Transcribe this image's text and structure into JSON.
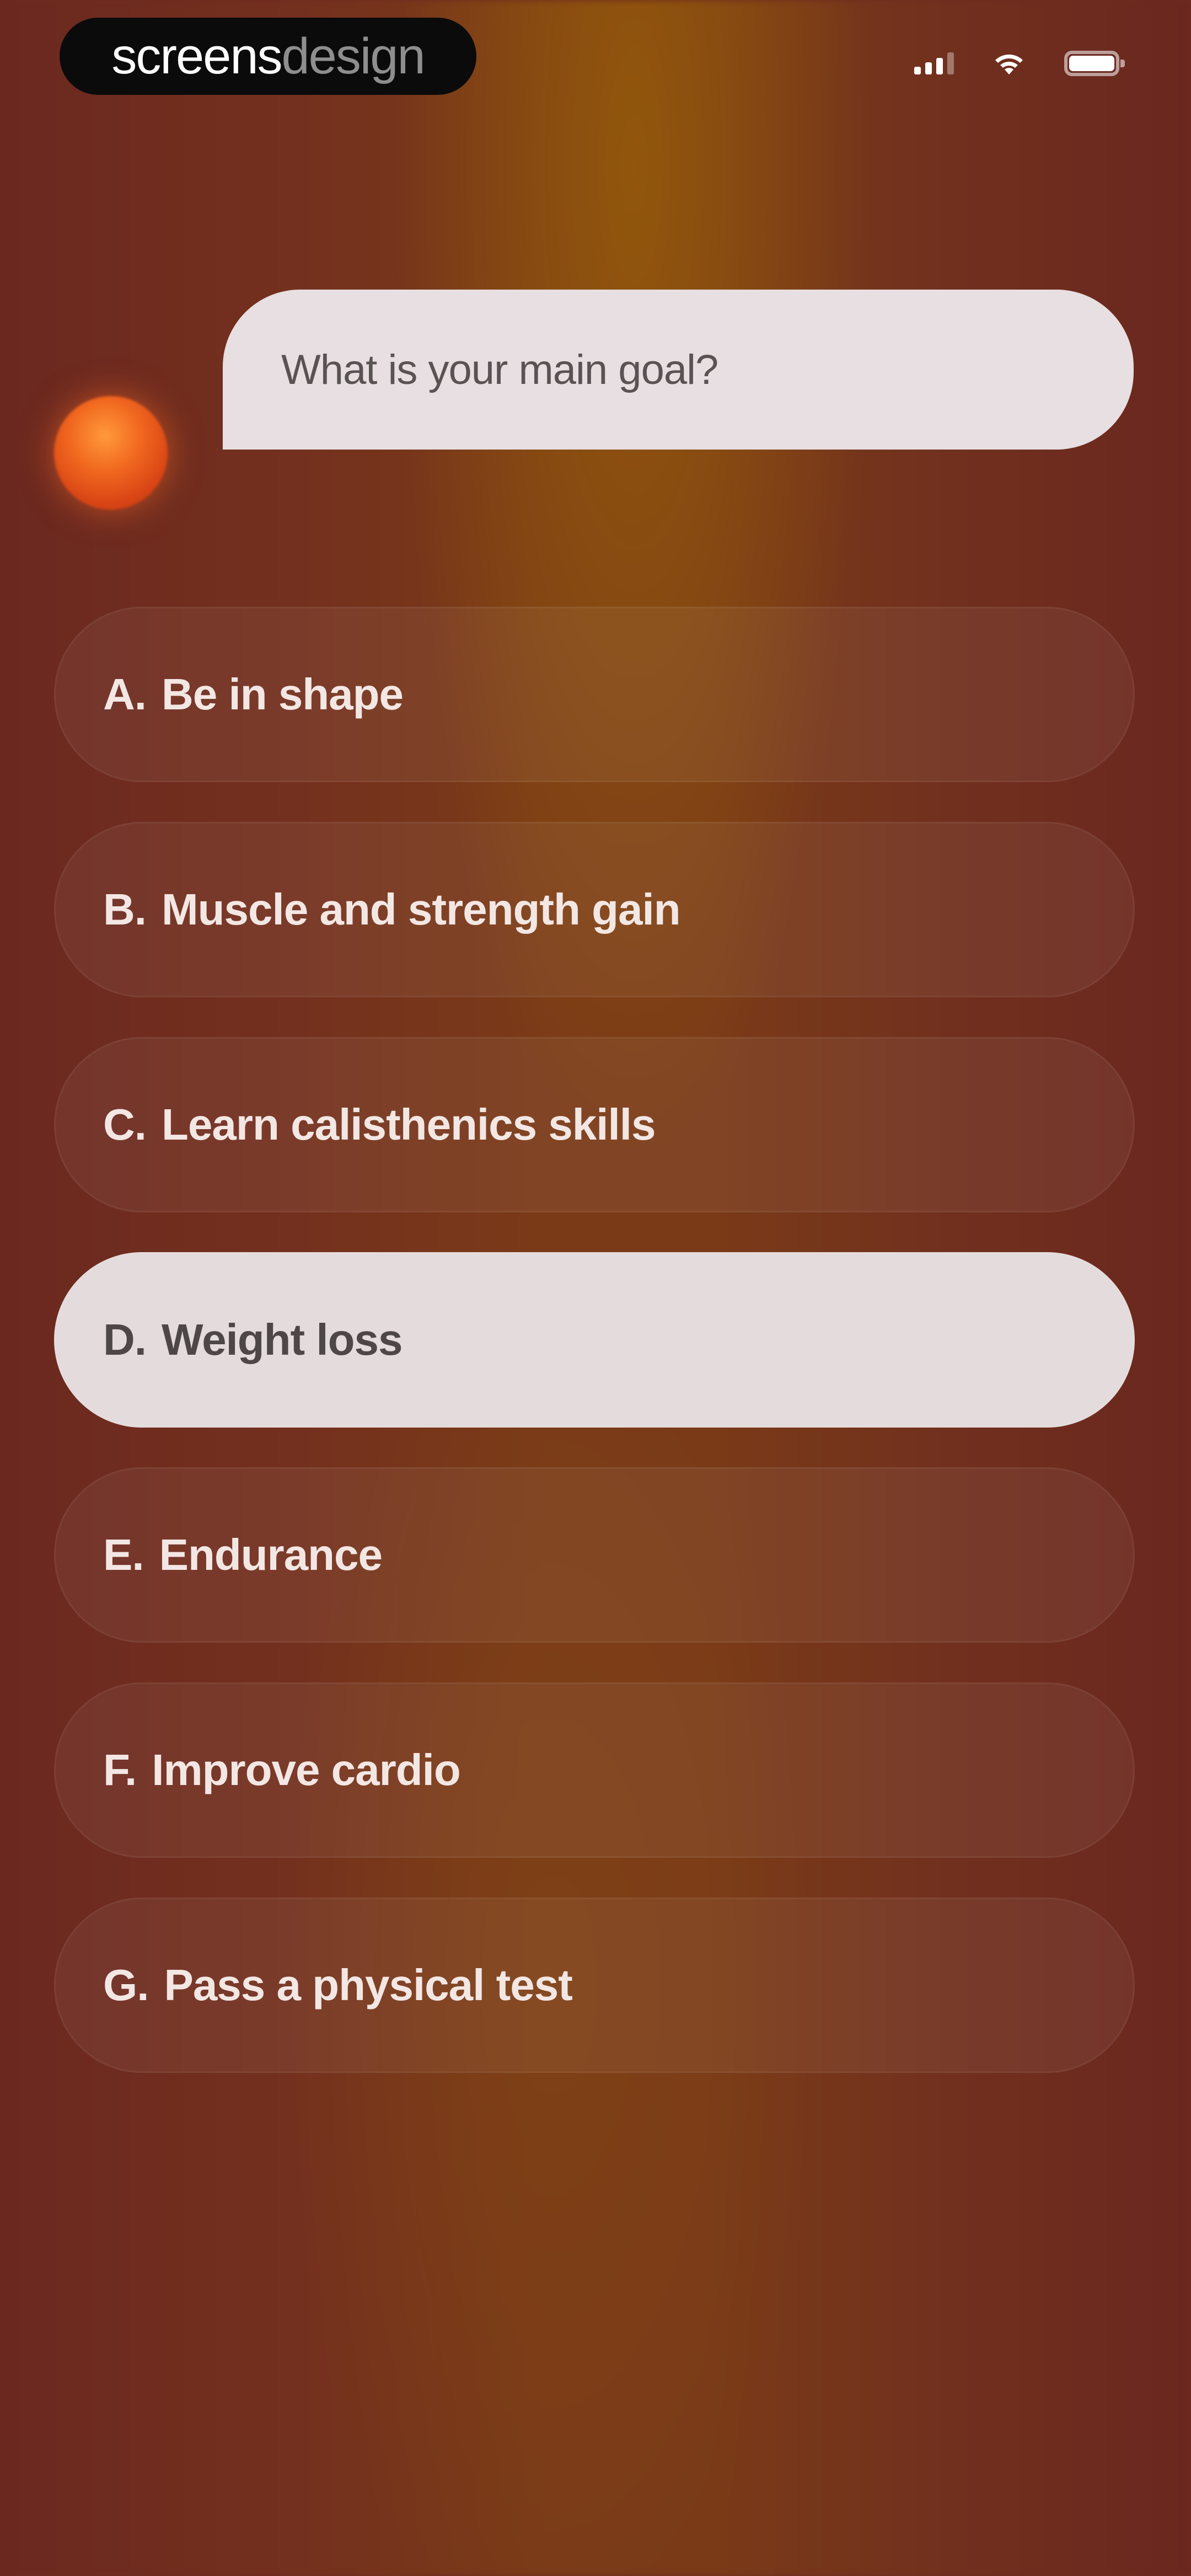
{
  "brand": {
    "part1": "screens",
    "part2": "design"
  },
  "question": "What is your main goal?",
  "selected_option": "D",
  "options": [
    {
      "letter": "A.",
      "label": "Be in shape"
    },
    {
      "letter": "B.",
      "label": "Muscle and strength gain"
    },
    {
      "letter": "C.",
      "label": "Learn calisthenics skills"
    },
    {
      "letter": "D.",
      "label": "Weight loss"
    },
    {
      "letter": "E.",
      "label": "Endurance"
    },
    {
      "letter": "F.",
      "label": "Improve cardio"
    },
    {
      "letter": "G.",
      "label": "Pass a physical test"
    }
  ],
  "status_icons": [
    "signal-icon",
    "wifi-icon",
    "battery-icon"
  ],
  "colors": {
    "background": "#6e2a1f",
    "accent_glow": "#965c0a",
    "bubble": "#e7dfe1",
    "orb": "#f26a20"
  }
}
